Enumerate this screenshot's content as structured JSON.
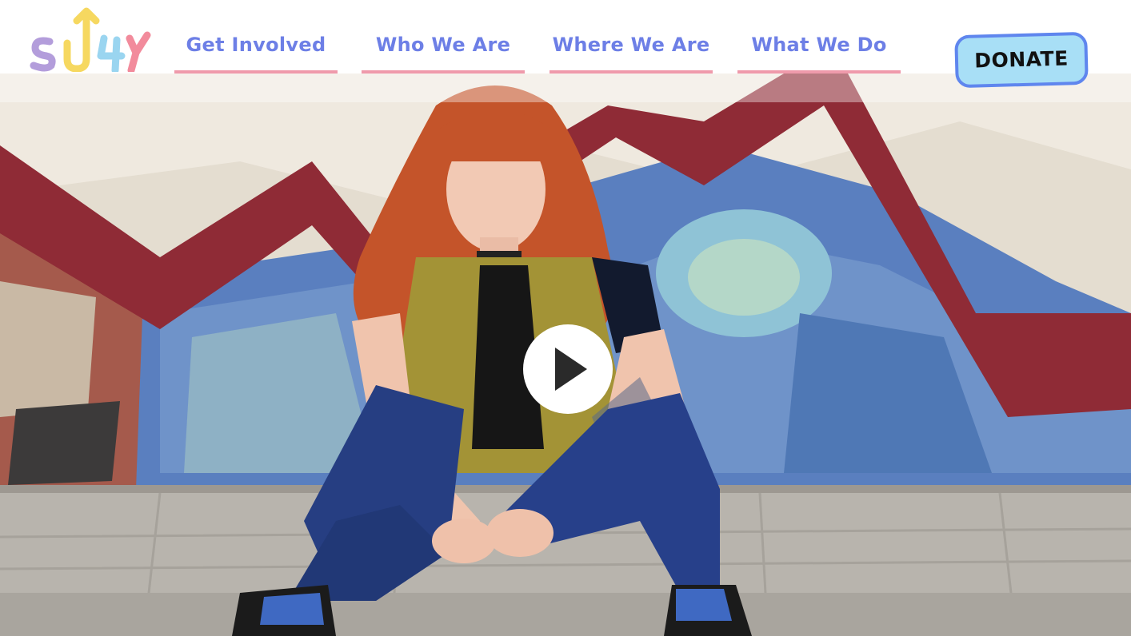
{
  "brand": {
    "logo_text": "SUYY",
    "logo_colors": [
      "#b39ddb",
      "#f6d860",
      "#9ad5f0",
      "#f28b9c"
    ]
  },
  "nav": {
    "items": [
      {
        "label": "Get Involved"
      },
      {
        "label": "Who We Are"
      },
      {
        "label": "Where We Are"
      },
      {
        "label": "What We Do"
      }
    ]
  },
  "header": {
    "donate_label": "DONATE"
  },
  "hero": {
    "media": "video",
    "play_icon": "play-icon"
  },
  "colors": {
    "nav_text": "#6d7fe6",
    "nav_underline": "#ef9aab",
    "donate_bg": "#a8dff6",
    "donate_border": "#5f86ee"
  }
}
